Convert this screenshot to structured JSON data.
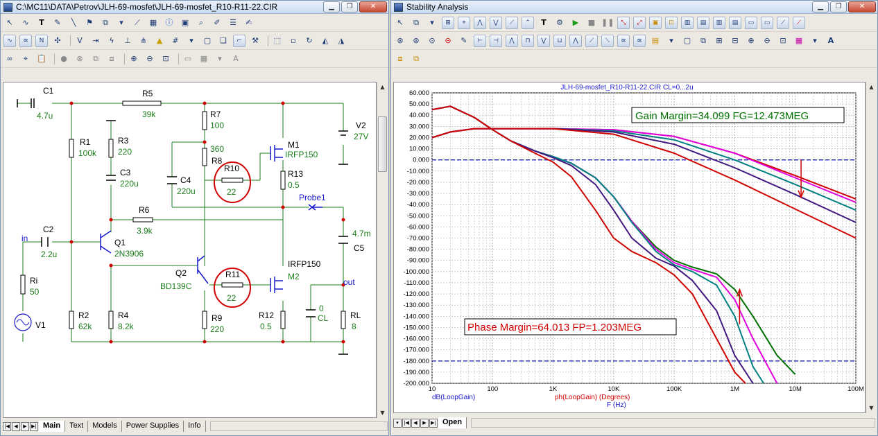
{
  "schematic_window": {
    "title": "C:\\MC11\\DATA\\Petrov\\JLH-69-mosfet\\JLH-69-mosfet_R10-R11-22.CIR",
    "tabs": [
      "Main",
      "Text",
      "Models",
      "Power Supplies",
      "Info"
    ],
    "active_tab": "Main",
    "components": {
      "C1": {
        "name": "C1",
        "value": "4.7u"
      },
      "R5": {
        "name": "R5",
        "value": "39k"
      },
      "R7": {
        "name": "R7",
        "value": "100"
      },
      "V2": {
        "name": "V2",
        "value": "27V"
      },
      "R1": {
        "name": "R1",
        "value": "100k"
      },
      "R3": {
        "name": "R3",
        "value": "220"
      },
      "R8": {
        "name": "R8",
        "value": "360"
      },
      "M1": {
        "name": "M1",
        "value": "IRFP150"
      },
      "C3": {
        "name": "C3",
        "value": "220u"
      },
      "C4": {
        "name": "C4",
        "value": "220u"
      },
      "R10": {
        "name": "R10",
        "value": "22"
      },
      "R13": {
        "name": "R13",
        "value": "0.5"
      },
      "Probe1": {
        "name": "Probe1"
      },
      "R6": {
        "name": "R6",
        "value": "3.9k"
      },
      "C5": {
        "name": "C5",
        "value": "4.7m"
      },
      "C2": {
        "name": "C2",
        "value": "2.2u"
      },
      "Q1": {
        "name": "Q1",
        "value": "2N3906"
      },
      "Q2": {
        "name": "Q2",
        "value": "BD139C"
      },
      "R11": {
        "name": "R11",
        "value": "22"
      },
      "M2": {
        "name": "M2",
        "value": "IRFP150"
      },
      "Ri": {
        "name": "Ri",
        "value": "50"
      },
      "V1": {
        "name": "V1"
      },
      "R2": {
        "name": "R2",
        "value": "62k"
      },
      "R4": {
        "name": "R4",
        "value": "8.2k"
      },
      "R9": {
        "name": "R9",
        "value": "220"
      },
      "R12": {
        "name": "R12",
        "value": "0.5"
      },
      "CL": {
        "name": "CL",
        "value": "0"
      },
      "RL": {
        "name": "RL",
        "value": "8"
      }
    },
    "nodes": {
      "in": "in",
      "out": "out"
    },
    "highlight_color": "#d00000"
  },
  "stability_window": {
    "title": "Stability Analysis",
    "tabs": [
      "Open"
    ],
    "active_tab": "Open"
  },
  "chart_data": {
    "type": "line",
    "title": "JLH-69-mosfet_R10-R11-22.CIR CL=0...2u",
    "xlabel": "F (Hz)",
    "x_scale": "log",
    "xlim": [
      10,
      100000000
    ],
    "x_ticks": [
      "10",
      "100",
      "1K",
      "10K",
      "100K",
      "1M",
      "10M",
      "100M"
    ],
    "ylim": [
      -200,
      60
    ],
    "y_ticks": [
      "60.000",
      "50.000",
      "40.000",
      "30.000",
      "20.000",
      "10.000",
      "0.000",
      "-10.000",
      "-20.000",
      "-30.000",
      "-40.000",
      "-50.000",
      "-60.000",
      "-70.000",
      "-80.000",
      "-90.000",
      "-100.000",
      "-110.000",
      "-120.000",
      "-130.000",
      "-140.000",
      "-150.000",
      "-160.000",
      "-170.000",
      "-180.000",
      "-190.000",
      "-200.000"
    ],
    "grid": true,
    "reference_lines": [
      0,
      -180
    ],
    "y_legend": [
      {
        "label": "dB(LoopGain)",
        "color": "#1818cc"
      },
      {
        "label": "ph(LoopGain) (Degrees)",
        "color": "#d00000"
      }
    ],
    "annotations": {
      "gain_margin": {
        "text": "Gain Margin=34.099 FG=12.473MEG",
        "color": "#007000",
        "x": 12473000,
        "y": 0
      },
      "phase_margin": {
        "text": "Phase Margin=64.013 FP=1.203MEG",
        "color": "#d00000",
        "x": 1203000,
        "y": -116
      }
    },
    "gain_series": [
      {
        "color": "#d00000",
        "x": [
          10,
          20,
          50,
          100,
          1000,
          10000,
          100000,
          1000000,
          10000000,
          100000000
        ],
        "y": [
          20,
          25,
          28,
          28,
          28,
          27,
          21,
          6,
          -14,
          -35
        ]
      },
      {
        "color": "#e000e0",
        "x": [
          10,
          20,
          50,
          100,
          1000,
          10000,
          100000,
          1000000,
          10000000,
          100000000
        ],
        "y": [
          20,
          25,
          28,
          28,
          28,
          27,
          21,
          6,
          -16,
          -38
        ]
      },
      {
        "color": "#008080",
        "x": [
          10,
          20,
          50,
          100,
          1000,
          10000,
          100000,
          1000000,
          10000000,
          100000000
        ],
        "y": [
          20,
          25,
          28,
          28,
          28,
          26,
          18,
          0,
          -22,
          -45
        ]
      },
      {
        "color": "#401880",
        "x": [
          10,
          20,
          50,
          100,
          1000,
          10000,
          100000,
          1000000,
          10000000,
          100000000
        ],
        "y": [
          20,
          25,
          28,
          28,
          28,
          25,
          14,
          -7,
          -31,
          -56
        ]
      },
      {
        "color": "#d00000",
        "x": [
          10,
          20,
          50,
          100,
          1000,
          10000,
          100000,
          1000000,
          10000000,
          100000000
        ],
        "y": [
          20,
          25,
          28,
          28,
          28,
          23,
          6,
          -18,
          -44,
          -70
        ]
      }
    ],
    "phase_series": [
      {
        "color": "#007000",
        "x": [
          10,
          20,
          50,
          100,
          200,
          500,
          1000,
          2000,
          5000,
          10000,
          20000,
          50000,
          100000,
          200000,
          500000,
          1000000,
          2000000,
          5000000,
          10000000
        ],
        "y": [
          45,
          48,
          38,
          27,
          17,
          8,
          3,
          -3,
          -16,
          -33,
          -55,
          -78,
          -90,
          -96,
          -102,
          -116,
          -140,
          -175,
          -192
        ]
      },
      {
        "color": "#e000e0",
        "x": [
          10,
          20,
          50,
          100,
          200,
          500,
          1000,
          2000,
          5000,
          10000,
          20000,
          50000,
          100000,
          200000,
          500000,
          1000000,
          2000000,
          5000000
        ],
        "y": [
          45,
          48,
          38,
          27,
          17,
          8,
          3,
          -3,
          -16,
          -33,
          -55,
          -80,
          -92,
          -98,
          -105,
          -125,
          -160,
          -200
        ]
      },
      {
        "color": "#008080",
        "x": [
          10,
          20,
          50,
          100,
          200,
          500,
          1000,
          2000,
          5000,
          10000,
          20000,
          50000,
          100000,
          200000,
          500000,
          1000000,
          2000000,
          3000000
        ],
        "y": [
          45,
          48,
          38,
          27,
          17,
          8,
          3,
          -3,
          -16,
          -33,
          -56,
          -82,
          -94,
          -100,
          -112,
          -140,
          -185,
          -200
        ]
      },
      {
        "color": "#401880",
        "x": [
          10,
          20,
          50,
          100,
          200,
          500,
          1000,
          2000,
          5000,
          10000,
          20000,
          50000,
          100000,
          200000,
          500000,
          1000000,
          2000000
        ],
        "y": [
          45,
          48,
          38,
          27,
          17,
          8,
          2,
          -5,
          -22,
          -45,
          -70,
          -88,
          -95,
          -108,
          -135,
          -175,
          -200
        ]
      },
      {
        "color": "#d00000",
        "x": [
          10,
          20,
          50,
          100,
          200,
          500,
          1000,
          2000,
          5000,
          10000,
          20000,
          50000,
          100000,
          200000,
          500000,
          1000000,
          1500000
        ],
        "y": [
          45,
          48,
          38,
          27,
          17,
          6,
          -2,
          -15,
          -45,
          -70,
          -82,
          -92,
          -103,
          -120,
          -160,
          -190,
          -200
        ]
      }
    ]
  }
}
